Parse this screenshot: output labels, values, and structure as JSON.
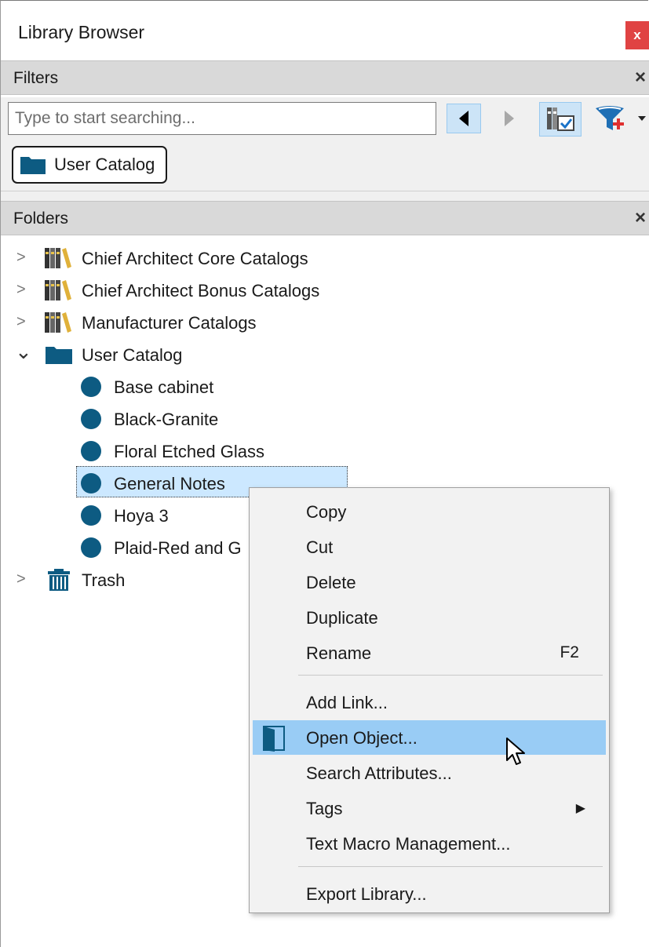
{
  "window": {
    "title": "Library Browser",
    "close_label": "x"
  },
  "filters": {
    "header": "Filters",
    "close_label": "×",
    "search_placeholder": "Type to start searching...",
    "chip_label": "User Catalog"
  },
  "folders": {
    "header": "Folders",
    "close_label": "×",
    "items": [
      {
        "label": "Chief Architect Core Catalogs",
        "icon": "catalog-books-icon",
        "expander": ">"
      },
      {
        "label": "Chief Architect Bonus Catalogs",
        "icon": "catalog-books-icon",
        "expander": ">"
      },
      {
        "label": "Manufacturer Catalogs",
        "icon": "catalog-books-icon",
        "expander": ">"
      },
      {
        "label": "User Catalog",
        "icon": "folder-icon",
        "expander": "⌄"
      },
      {
        "label": "Base cabinet",
        "icon": "object-dot-icon"
      },
      {
        "label": "Black-Granite",
        "icon": "object-dot-icon"
      },
      {
        "label": "Floral Etched Glass",
        "icon": "object-dot-icon"
      },
      {
        "label": "General Notes",
        "icon": "object-dot-icon",
        "selected": true
      },
      {
        "label": "Hoya 3",
        "icon": "object-dot-icon"
      },
      {
        "label": "Plaid-Red and G",
        "icon": "object-dot-icon"
      },
      {
        "label": "Trash",
        "icon": "trash-icon",
        "expander": ">"
      }
    ]
  },
  "context_menu": {
    "items": [
      {
        "label": "Copy"
      },
      {
        "label": "Cut"
      },
      {
        "label": "Delete"
      },
      {
        "label": "Duplicate"
      },
      {
        "label": "Rename",
        "shortcut": "F2"
      },
      {
        "label": "Add Link..."
      },
      {
        "label": "Open Object...",
        "highlighted": true,
        "icon": "open-object-icon"
      },
      {
        "label": "Search Attributes..."
      },
      {
        "label": "Tags",
        "submenu": "▶"
      },
      {
        "label": "Text Macro Management..."
      },
      {
        "label": "Export Library..."
      }
    ]
  },
  "colors": {
    "accent_blue": "#0d5b82",
    "selection": "#cce8ff",
    "menu_highlight": "#99ccf5",
    "close_red": "#e04343"
  }
}
